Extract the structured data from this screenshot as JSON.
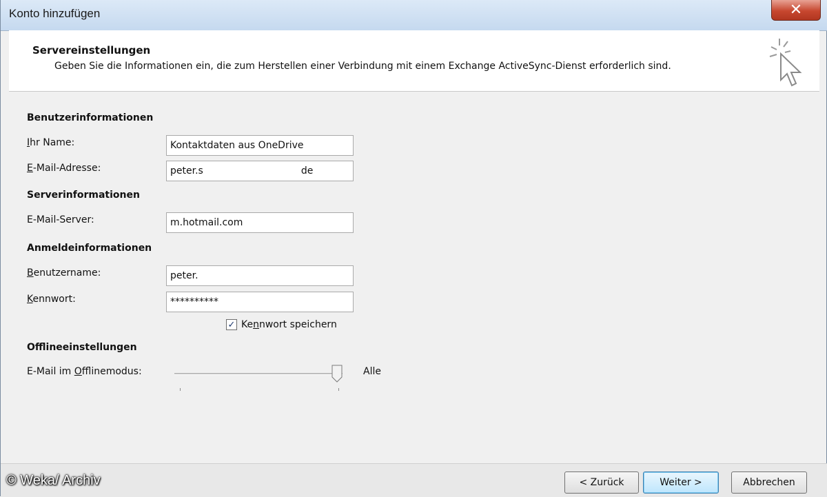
{
  "window": {
    "title": "Konto hinzufügen",
    "close_glyph": "✕"
  },
  "header": {
    "title": "Servereinstellungen",
    "description": "Geben Sie die Informationen ein, die zum Herstellen einer Verbindung mit einem Exchange ActiveSync-Dienst erforderlich sind.",
    "icon": "cursor-sparkle-icon"
  },
  "sections": {
    "user": "Benutzerinformationen",
    "server": "Serverinformationen",
    "login": "Anmeldeinformationen",
    "offline": "Offlineeinstellungen"
  },
  "fields": {
    "name": {
      "label_accel": "I",
      "label_rest": "hr Name:",
      "value": "Kontaktdaten aus OneDrive"
    },
    "email": {
      "label_accel": "E",
      "label_rest": "-Mail-Adresse:",
      "value_start": "peter.s",
      "value_end": "de"
    },
    "server": {
      "label": "E-Mail-Server:",
      "value": "m.hotmail.com"
    },
    "username": {
      "label_accel": "B",
      "label_rest": "enutzername:",
      "value": "peter."
    },
    "password": {
      "label_accel": "K",
      "label_rest": "ennwort:",
      "value": "**********"
    }
  },
  "remember_password": {
    "checked": true,
    "check_glyph": "✓",
    "label_pre": "Ke",
    "label_accel": "n",
    "label_post": "nwort speichern"
  },
  "offline_slider": {
    "label_pre": "E-Mail im ",
    "label_accel": "O",
    "label_post": "fflinemodus:",
    "value_label": "Alle",
    "position_fraction": 1.0
  },
  "buttons": {
    "back": "< Zurück",
    "next": "Weiter >",
    "cancel": "Abbrechen"
  },
  "watermark": "© Weka/ Archiv"
}
